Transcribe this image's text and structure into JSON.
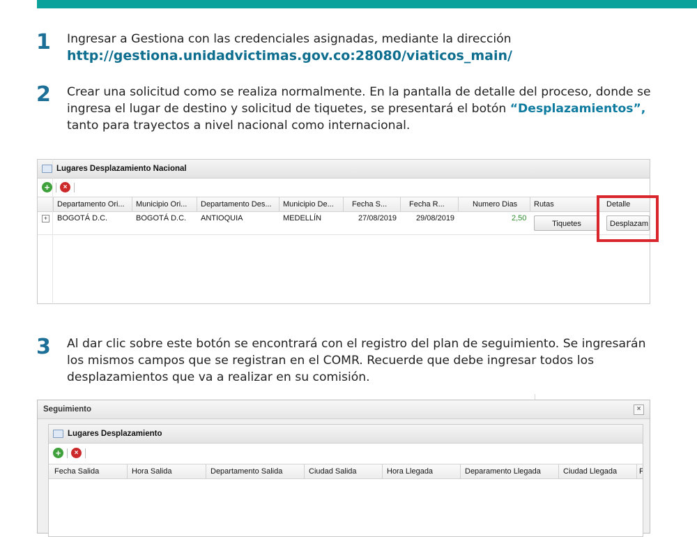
{
  "steps": [
    {
      "number": "1",
      "text": "Ingresar a Gestiona con las credenciales asignadas, mediante la dirección",
      "url": "http://gestiona.unidadvictimas.gov.co:28080/viaticos_main/"
    },
    {
      "number": "2",
      "text_before": "Crear una solicitud como se realiza normalmente. En la pantalla de detalle del proceso, donde se ingresa el lugar de destino y solicitud de tiquetes, se presentará el botón ",
      "highlight": "“Desplazamientos”,",
      "text_after": " tanto para trayectos a nivel nacional como internacional."
    },
    {
      "number": "3",
      "text": "Al dar clic sobre este botón se encontrará con el registro del plan de seguimiento. Se ingresarán los mismos campos que se registran en el COMR. Recuerde que debe ingresar todos los desplazamientos que va a realizar en su comisión."
    }
  ],
  "panel1": {
    "title": "Lugares Desplazamiento Nacional",
    "columns": [
      "Departamento Ori...",
      "Municipio Ori...",
      "Departamento Des...",
      "Municipio De...",
      "Fecha S...",
      "Fecha R...",
      "Numero Dias",
      "Rutas",
      "Detalle"
    ],
    "row": {
      "expander": "+",
      "departamento_origen": "BOGOTÁ D.C.",
      "municipio_origen": "BOGOTÁ D.C.",
      "departamento_destino": "ANTIOQUIA",
      "municipio_destino": "MEDELLÍN",
      "fecha_salida": "27/08/2019",
      "fecha_regreso": "29/08/2019",
      "numero_dias": "2,50",
      "rutas_button": "Tiquetes",
      "detalle_button": "Desplazam"
    },
    "colors": {
      "numero_dias": "#2e8b2e",
      "highlight_box": "#d9262c"
    }
  },
  "panel2": {
    "window_title": "Seguimiento",
    "close_glyph": "×",
    "inner_title": "Lugares Desplazamiento",
    "columns": [
      "Fecha Salida",
      "Hora Salida",
      "Departamento Salida",
      "Ciudad Salida",
      "Hora Llegada",
      "Deparamento Llegada",
      "Ciudad Llegada",
      "F"
    ]
  },
  "toolbar": {
    "add_glyph": "+",
    "delete_glyph": "×"
  },
  "colors": {
    "top_bar": "#0aa29a",
    "step_number": "#1c6f96",
    "url": "#0d6d8f"
  }
}
